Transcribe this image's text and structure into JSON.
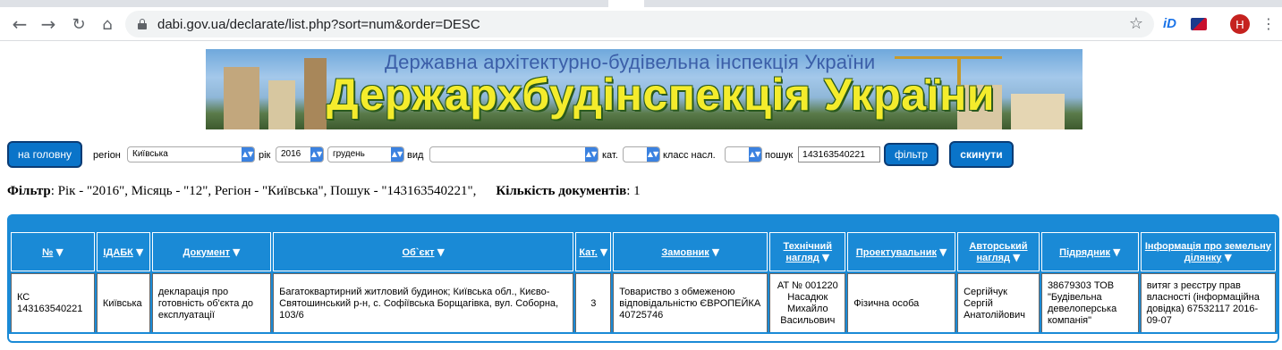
{
  "browser": {
    "url": "dabi.gov.ua/declarate/list.php?sort=num&order=DESC",
    "avatar_letter": "H",
    "icons": [
      "back-arrow-icon",
      "forward-arrow-icon",
      "reload-icon",
      "home-icon",
      "lock-icon",
      "star-icon",
      "menu-icon"
    ]
  },
  "banner": {
    "subtitle": "Державна архітектурно-будівельна інспекція України",
    "title": "Держархбудінспекція України"
  },
  "filterbar": {
    "home_button": "на головну",
    "region_label": "регіон",
    "region_value": "Київська",
    "year_label": "рік",
    "year_value": "2016",
    "month_value": "грудень",
    "type_label": "вид",
    "type_value": "",
    "cat_label": "кат.",
    "cat_value": "",
    "class_label": "класс насл.",
    "class_value": "",
    "search_label": "пошук",
    "search_value": "143163540221",
    "filter_button": "фільтр",
    "reset_button": "скинути"
  },
  "summary": {
    "filter_label": "Фільтр",
    "filter_text": ": Рік - \"2016\", Місяць - \"12\", Регіон - \"Київська\", Пошук - \"143163540221\",",
    "count_label": "Кількість документів",
    "count_value": ": 1"
  },
  "table": {
    "headers": [
      {
        "l1": "№",
        "l2": ""
      },
      {
        "l1": "ІДАБК",
        "l2": ""
      },
      {
        "l1": "Документ",
        "l2": ""
      },
      {
        "l1": "Об`єкт",
        "l2": ""
      },
      {
        "l1": "Кат.",
        "l2": ""
      },
      {
        "l1": "Замовник",
        "l2": ""
      },
      {
        "l1": "Технічний",
        "l2": "нагляд"
      },
      {
        "l1": "Проектувальник",
        "l2": ""
      },
      {
        "l1": "Авторський",
        "l2": "нагляд"
      },
      {
        "l1": "Підрядник",
        "l2": ""
      },
      {
        "l1": "Інформація про земельну",
        "l2": "ділянку"
      }
    ],
    "row": {
      "num": "КС 143163540221",
      "idabk": "Київська",
      "document": "декларація про готовність об'єкта до експлуатації",
      "object": "Багатоквартирний житловий будинок; Київська обл., Києво-Святошинський р-н, с. Софіївська Борщагівка, вул. Соборна, 103/6",
      "cat": "3",
      "customer": "Товариство з обмеженою відповідальністю ЄВРОПЕЙКА 40725746",
      "tech_supervision": "АТ № 001220 Насадюк Михайло Васильович",
      "designer": "Фізична особа",
      "author_supervision": "Сергійчук Сергій Анатолійович",
      "contractor": "38679303 ТОВ \"Будівельна девелоперська компанія\"",
      "land_info": "витяг з реєстру прав власності (інформаційна довідка) 67532117 2016-09-07"
    }
  }
}
